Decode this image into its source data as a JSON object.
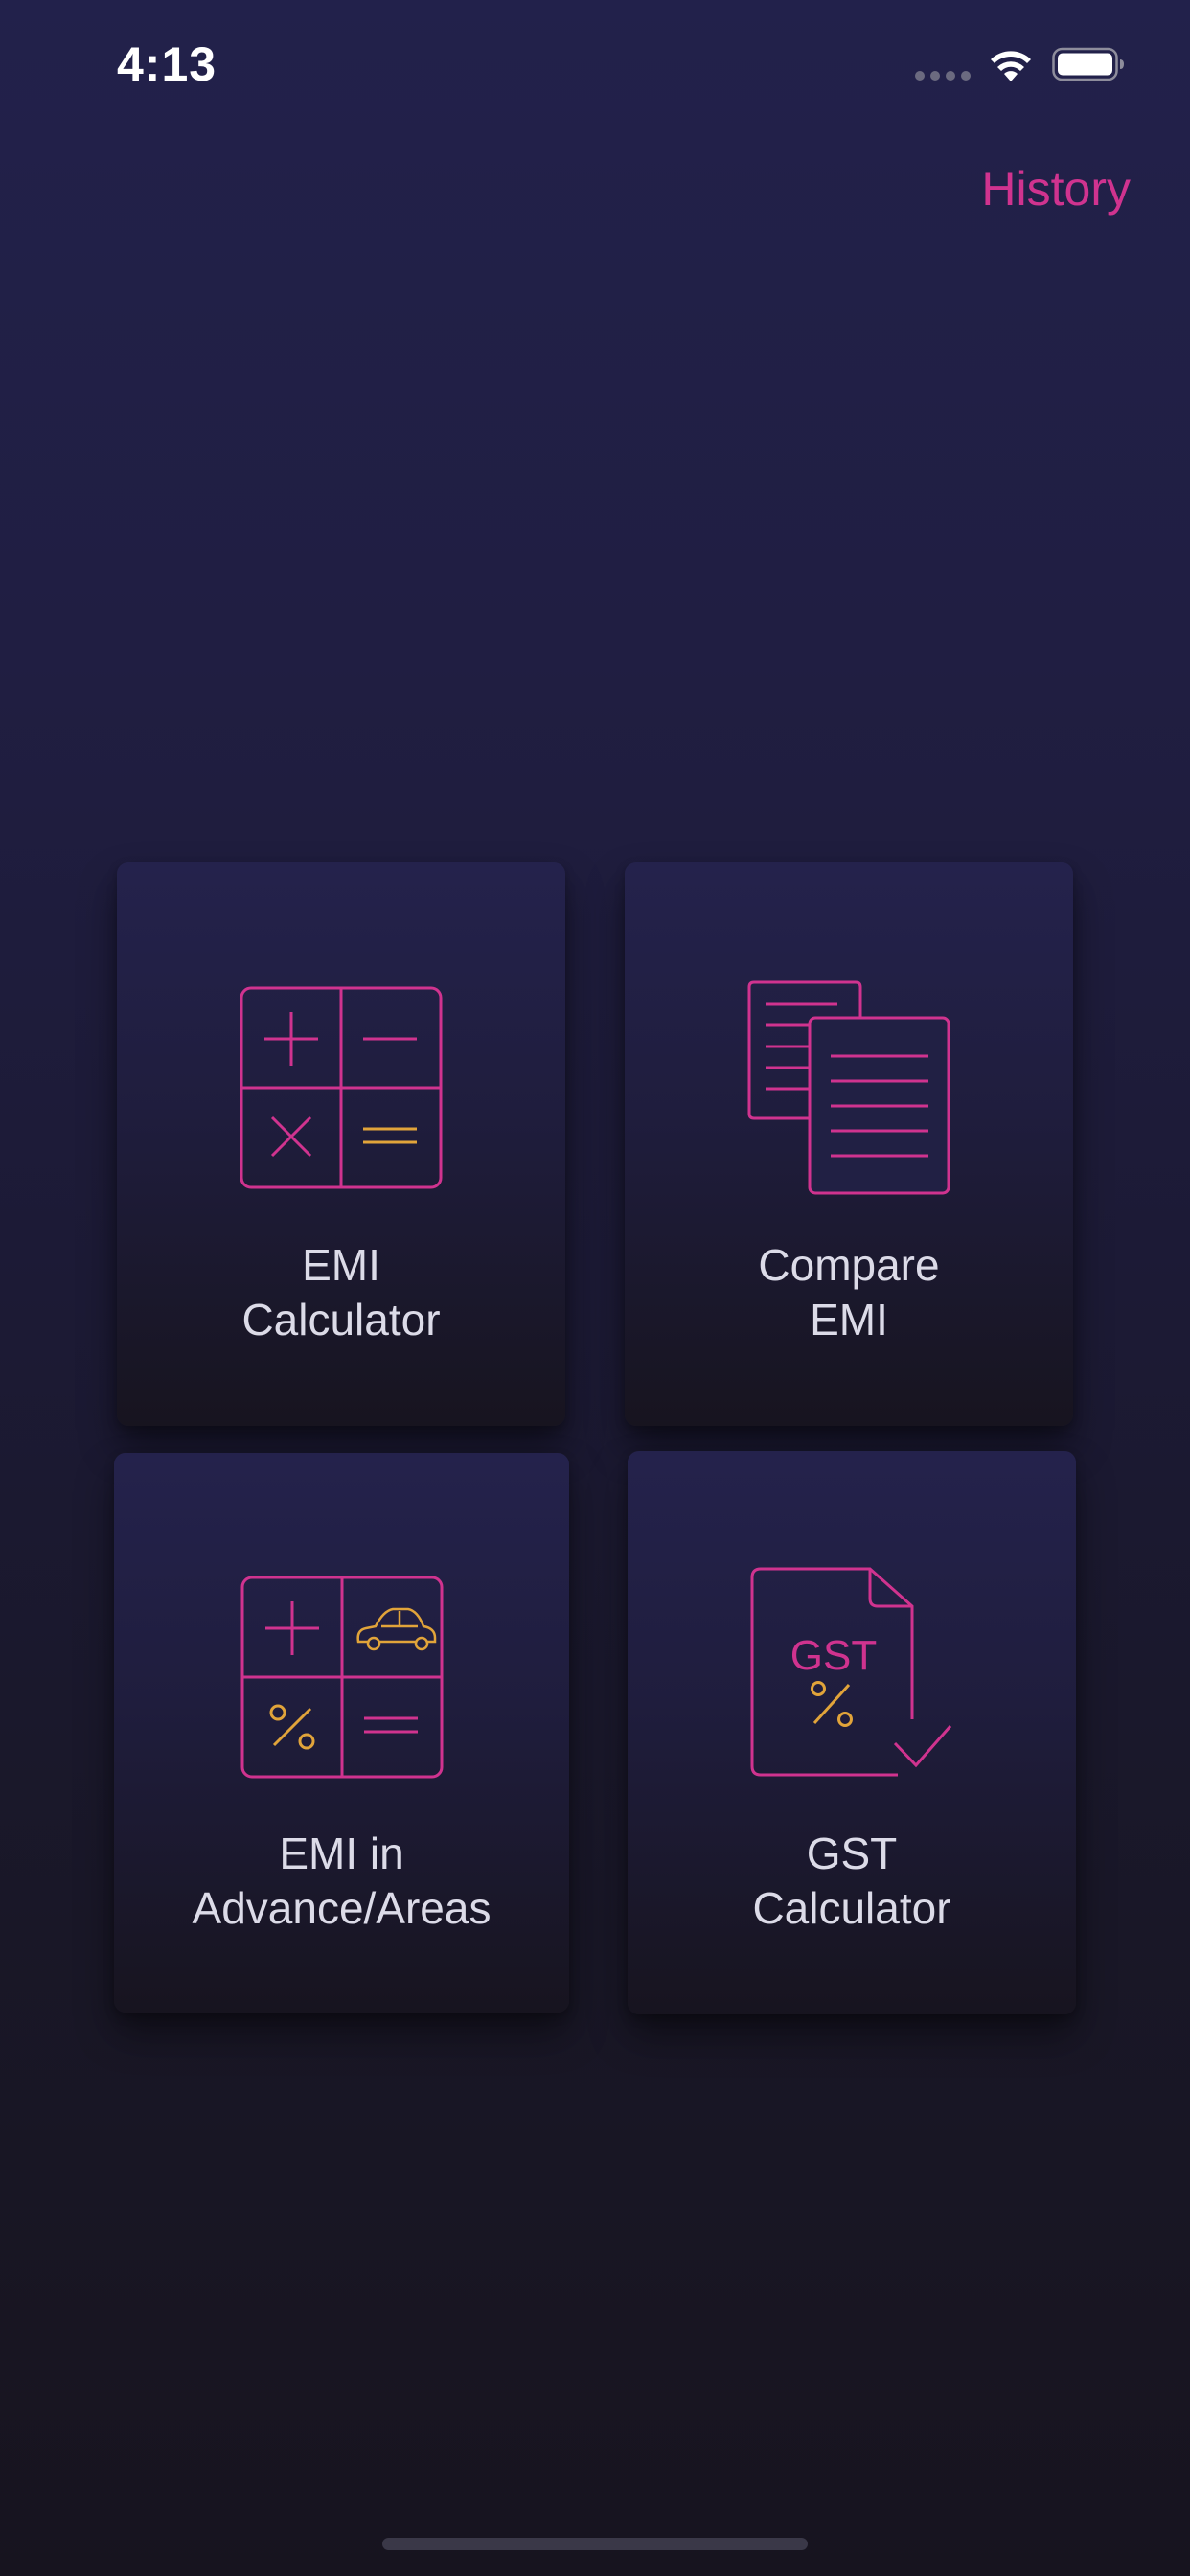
{
  "status_bar": {
    "time": "4:13"
  },
  "header": {
    "history_label": "History"
  },
  "colors": {
    "accent": "#d0338f",
    "icon_secondary": "#e1a43a",
    "background_top": "#22214b",
    "background_bottom": "#17141f"
  },
  "tiles": [
    {
      "line1": "EMI",
      "line2": "Calculator",
      "icon": "calculator-icon"
    },
    {
      "line1": "Compare",
      "line2": "EMI",
      "icon": "documents-icon"
    },
    {
      "line1": "EMI in",
      "line2": "Advance/Areas",
      "icon": "calculator-car-icon"
    },
    {
      "line1": "GST",
      "line2": "Calculator",
      "icon": "gst-document-icon",
      "icon_text": "GST"
    }
  ]
}
